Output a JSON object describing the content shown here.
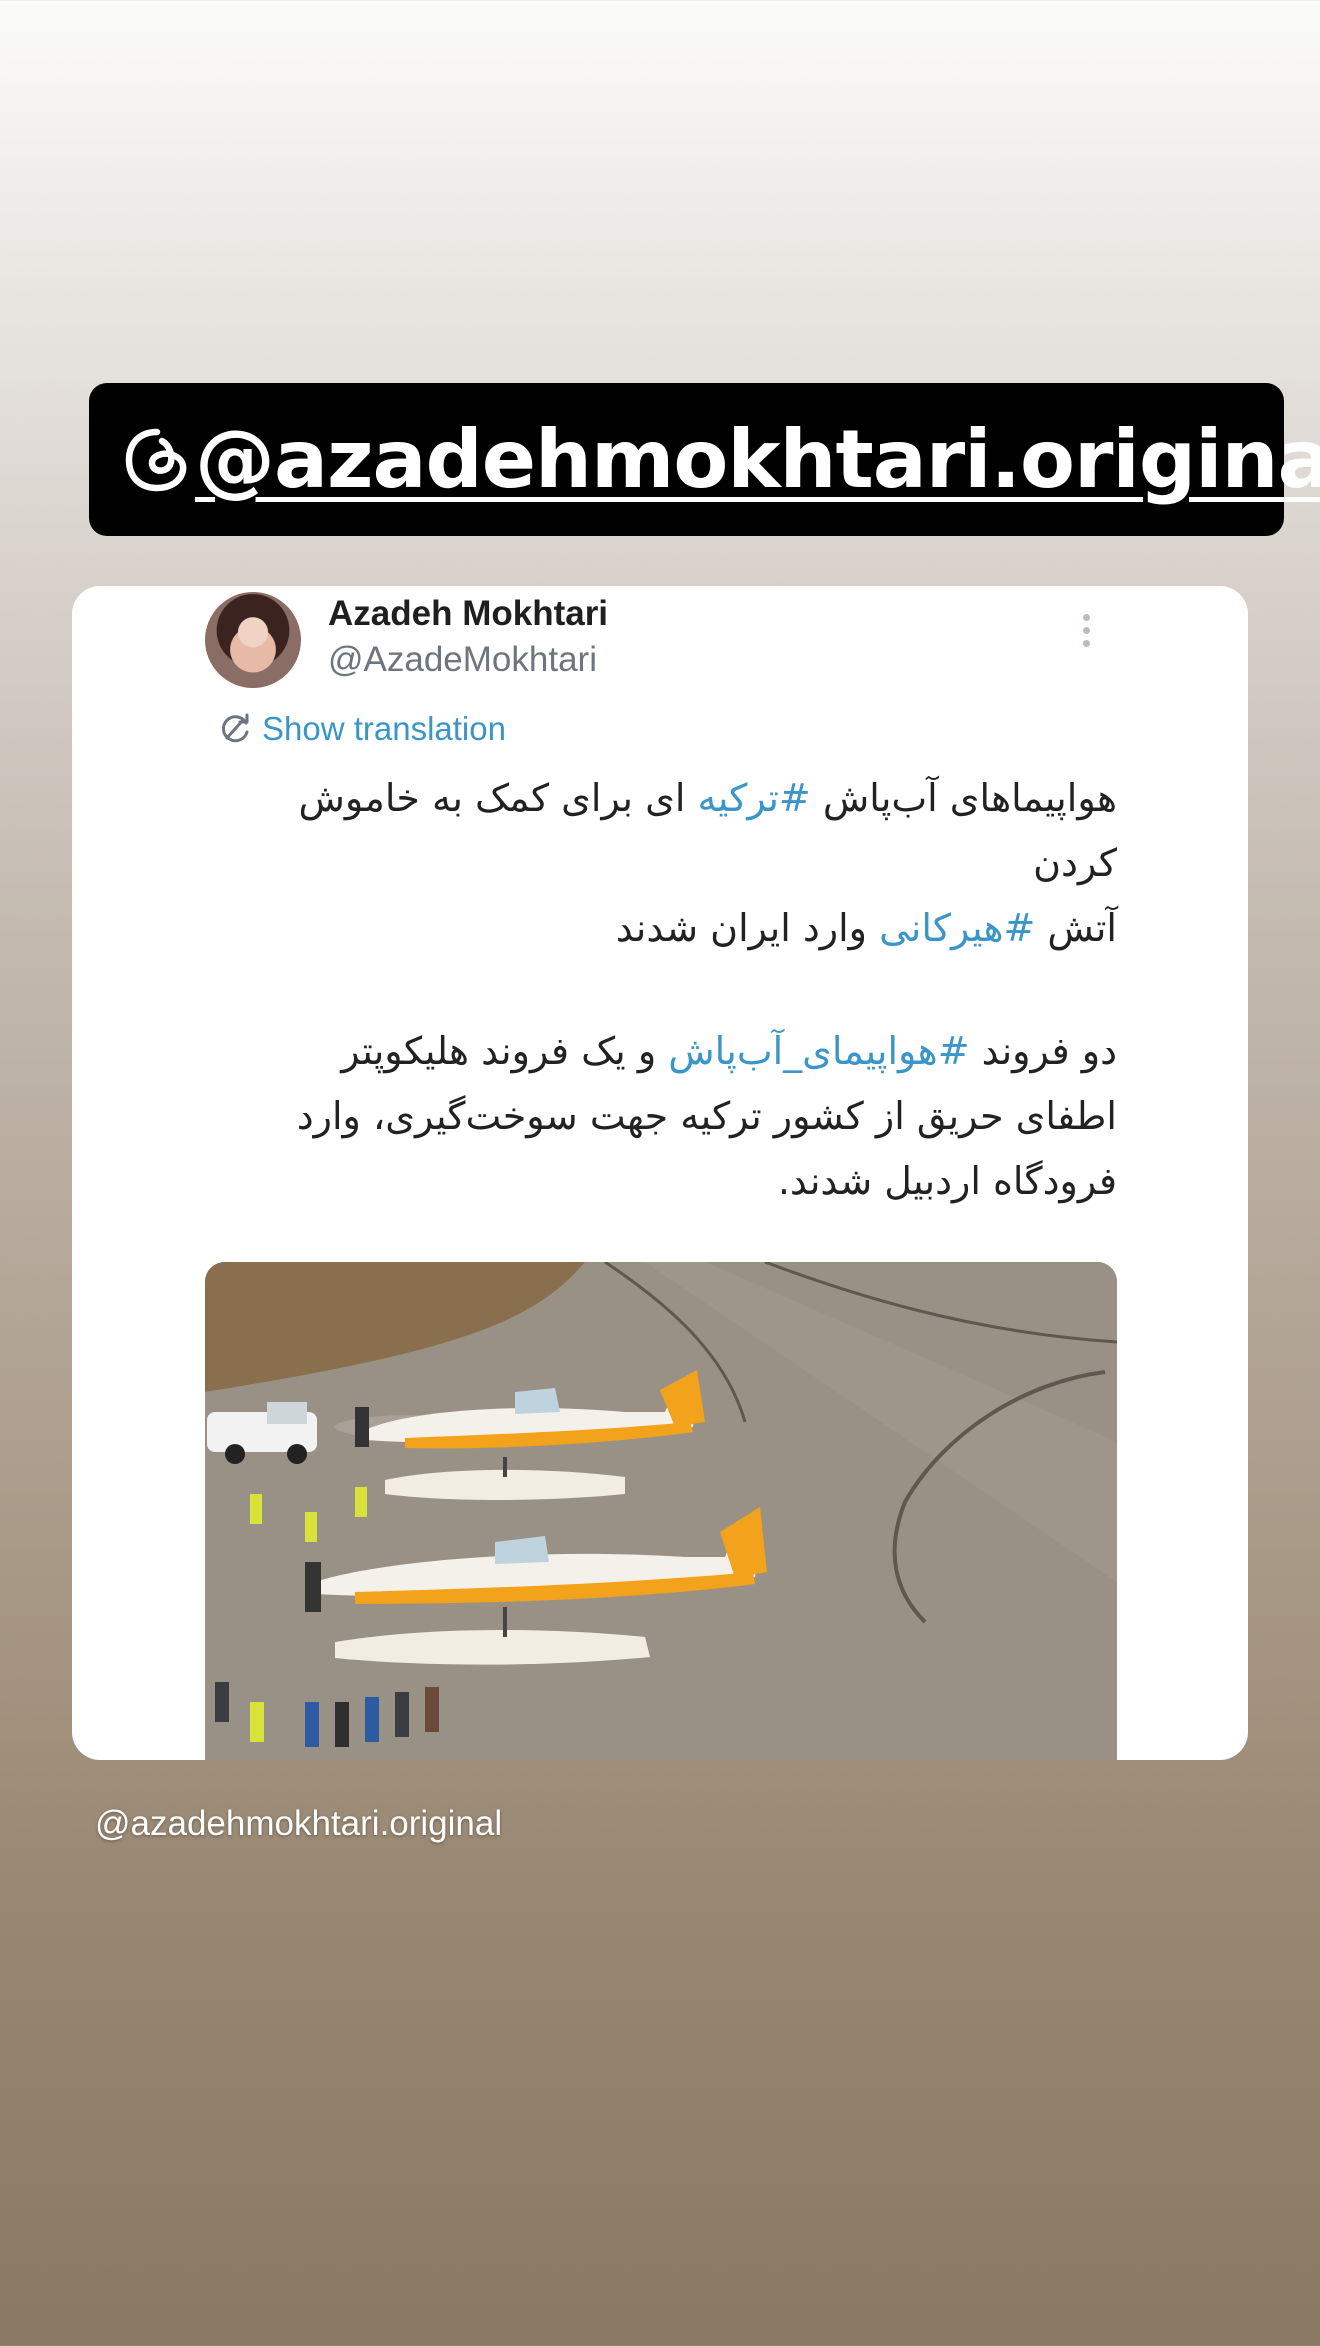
{
  "sticker": {
    "username": "@azadehmokhtari.original",
    "icon": "threads-icon"
  },
  "tweet": {
    "author_name": "Azadeh Mokhtari",
    "author_handle": "@AzadeMokhtari",
    "more_icon": "more-vertical-icon",
    "translate_label": "Show translation",
    "paragraph1": {
      "line1_pre": "هواپیماهای آب‌پاش ",
      "line1_tag": "#ترکیه",
      "line1_post": " ای برای کمک به خاموش کردن",
      "line2_pre": "آتش ",
      "line2_tag": "#هیرکانی",
      "line2_post": " وارد ایران شدند"
    },
    "paragraph2": {
      "pre": "دو فروند ",
      "tag": "#هواپیمای_آب‌پاش",
      "post": " و یک فروند هلیکوپتر اطفای حریق از کشور ترکیه جهت سوخت‌گیری، وارد فرودگاه اردبیل شدند."
    },
    "media_description_icon": "photo-of-firefighting-planes"
  },
  "footer": {
    "username": "@azadehmokhtari.original"
  },
  "colors": {
    "link": "#3a96c8",
    "sticker_bg": "#000000",
    "card_bg": "#ffffff"
  }
}
